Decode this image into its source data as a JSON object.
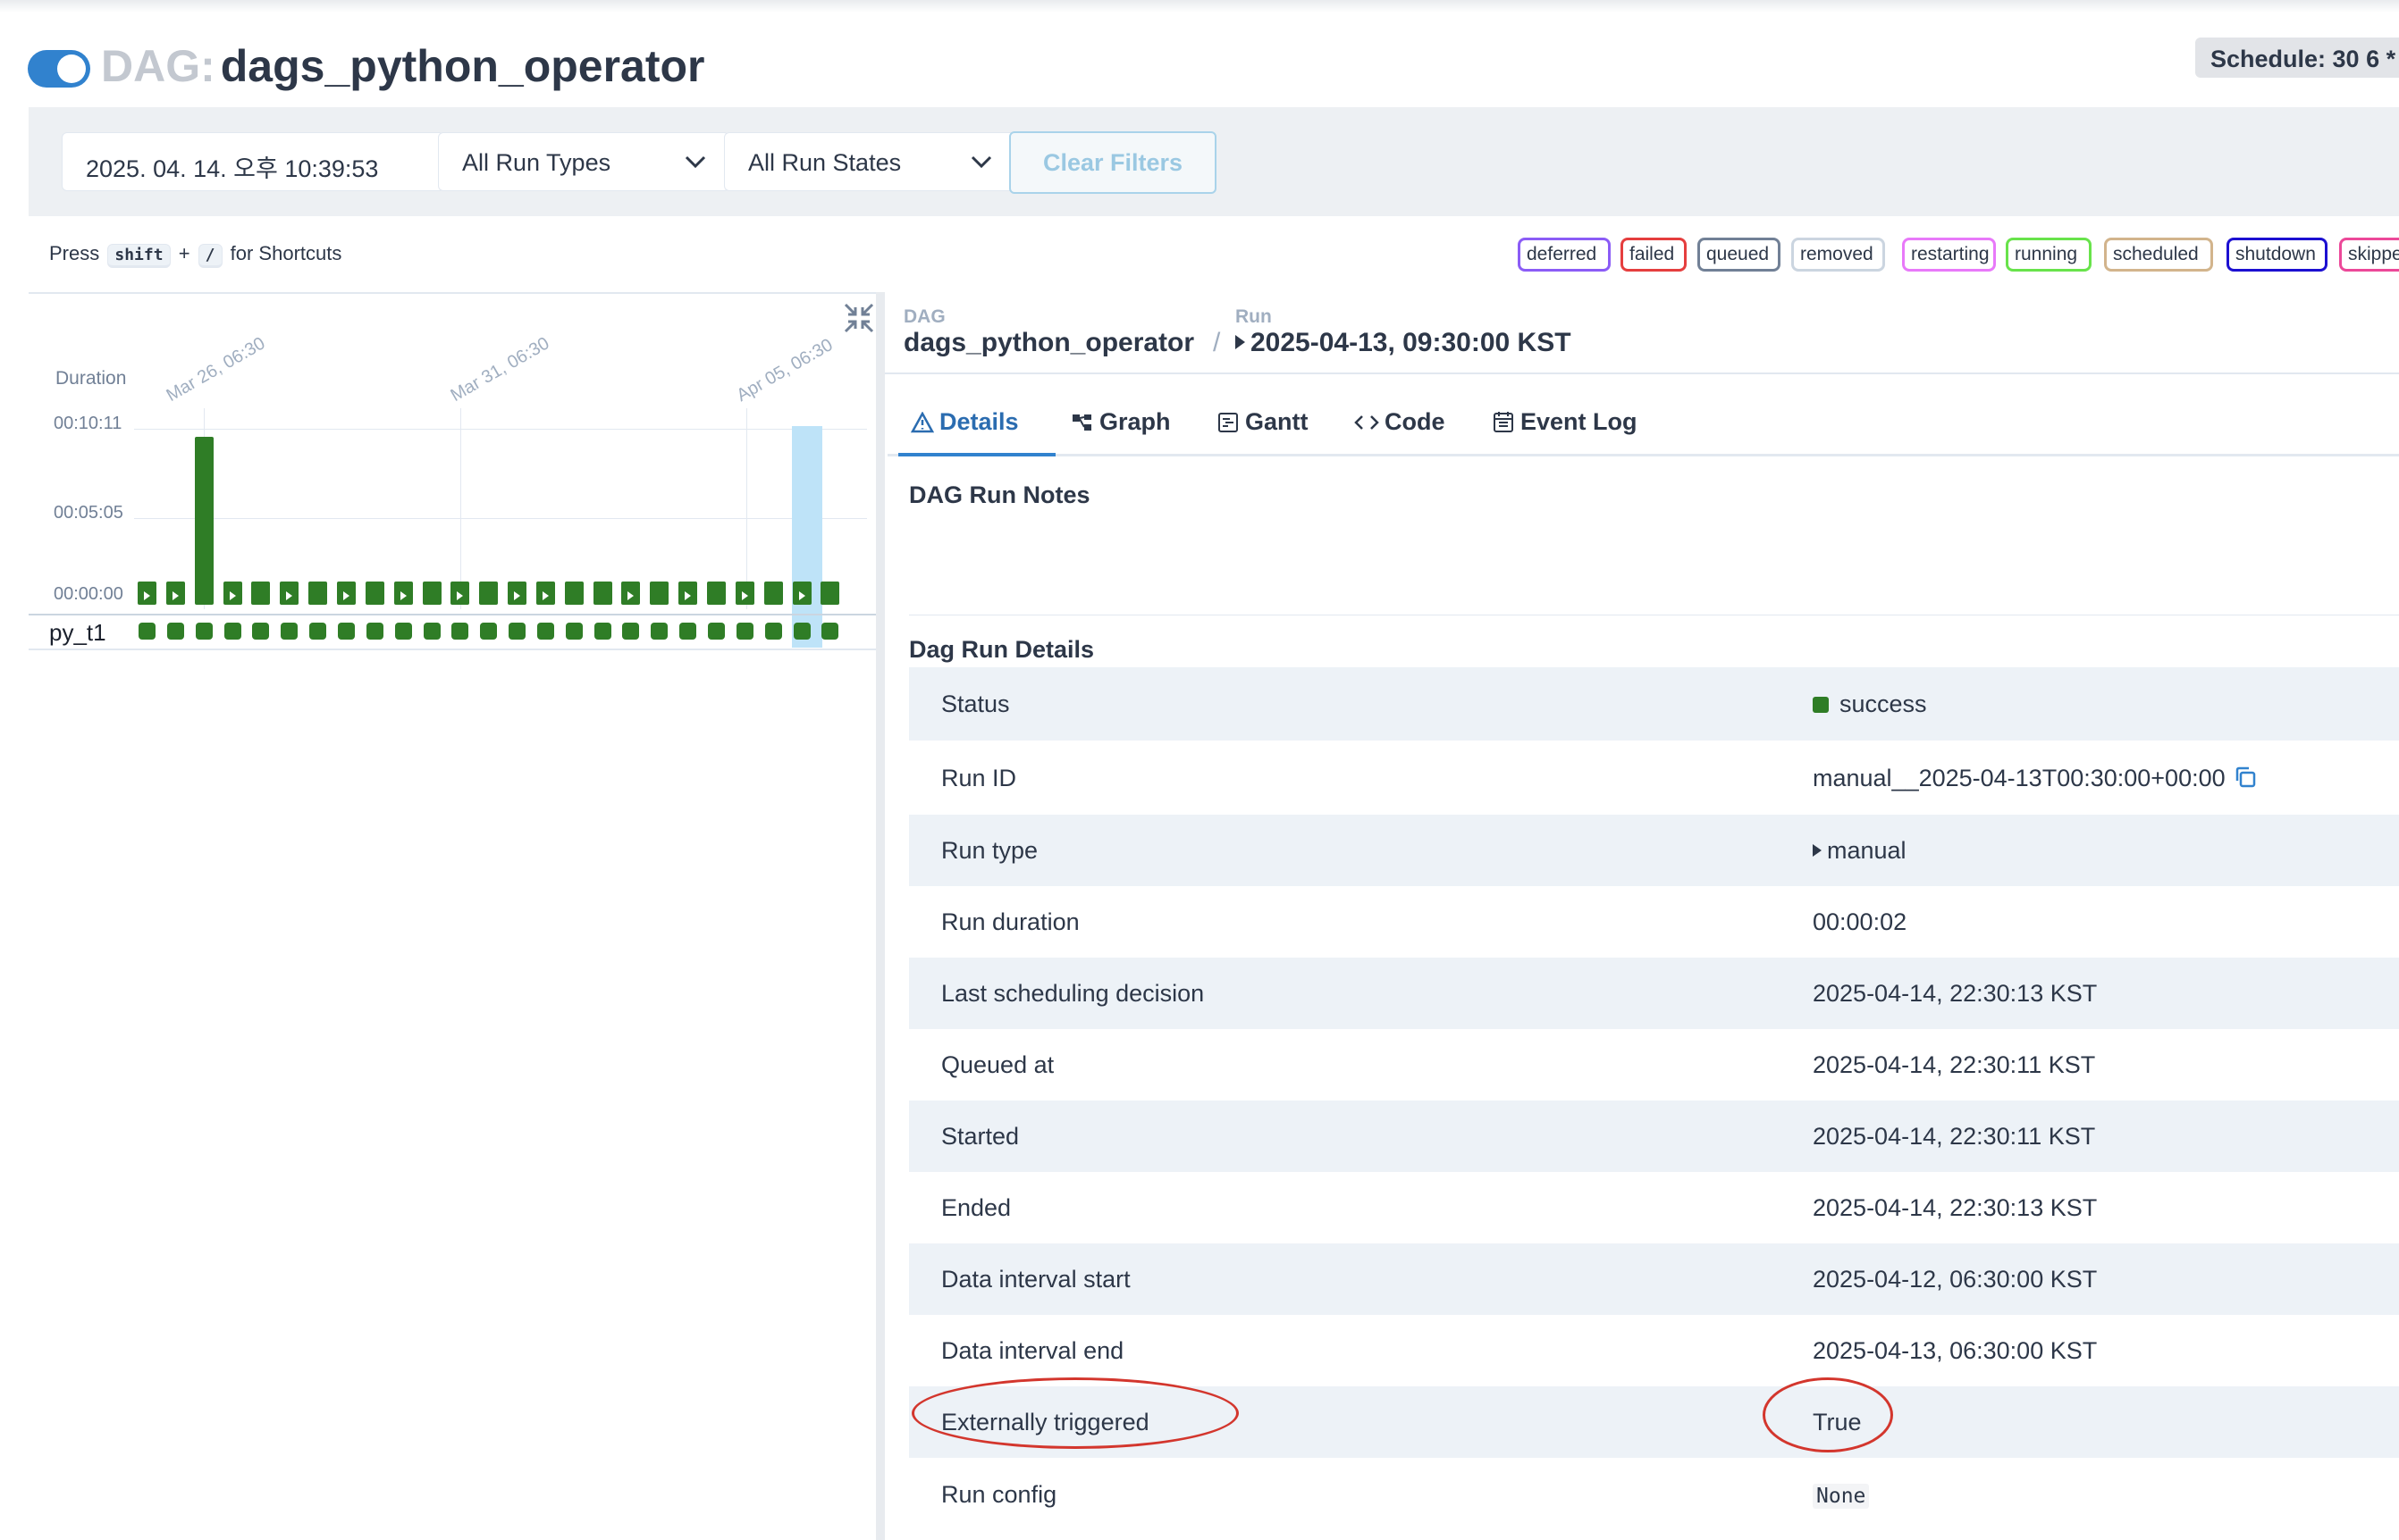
{
  "header": {
    "dag_prefix": "DAG:",
    "dag_name": "dags_python_operator",
    "schedule": "Schedule: 30 6 *",
    "toggle_on": true
  },
  "filters": {
    "date_value": "2025. 04. 14. 오후 10:39:53",
    "run_types": "All Run Types",
    "run_states": "All Run States",
    "clear": "Clear Filters"
  },
  "shortcut_hint": {
    "press": "Press",
    "key1": "shift",
    "plus": "+",
    "key2": "/",
    "suffix": "for Shortcuts"
  },
  "legend": [
    {
      "label": "deferred",
      "color": "#8b5cf6"
    },
    {
      "label": "failed",
      "color": "#e53e3e"
    },
    {
      "label": "queued",
      "color": "#718096"
    },
    {
      "label": "removed",
      "color": "#cbd5e0"
    },
    {
      "label": "restarting",
      "color": "#e879f9"
    },
    {
      "label": "running",
      "color": "#68e34b"
    },
    {
      "label": "scheduled",
      "color": "#d2b48c"
    },
    {
      "label": "shutdown",
      "color": "#1c10d1"
    },
    {
      "label": "skipped",
      "color": "#ec4899"
    }
  ],
  "grid": {
    "duration_label": "Duration",
    "y_ticks": [
      "00:10:11",
      "00:05:05",
      "00:00:00"
    ],
    "date_ticks": [
      "Mar 26, 06:30",
      "Mar 31, 06:30",
      "Apr 05, 06:30"
    ],
    "task_name": "py_t1",
    "runs": [
      {
        "tall": false,
        "manual": true
      },
      {
        "tall": false,
        "manual": true
      },
      {
        "tall": true,
        "manual": false
      },
      {
        "tall": false,
        "manual": true
      },
      {
        "tall": false,
        "manual": false
      },
      {
        "tall": false,
        "manual": true
      },
      {
        "tall": false,
        "manual": false
      },
      {
        "tall": false,
        "manual": true
      },
      {
        "tall": false,
        "manual": false
      },
      {
        "tall": false,
        "manual": true
      },
      {
        "tall": false,
        "manual": false
      },
      {
        "tall": false,
        "manual": true
      },
      {
        "tall": false,
        "manual": false
      },
      {
        "tall": false,
        "manual": true
      },
      {
        "tall": false,
        "manual": true
      },
      {
        "tall": false,
        "manual": false
      },
      {
        "tall": false,
        "manual": false
      },
      {
        "tall": false,
        "manual": true
      },
      {
        "tall": false,
        "manual": false
      },
      {
        "tall": false,
        "manual": true
      },
      {
        "tall": false,
        "manual": false
      },
      {
        "tall": false,
        "manual": true
      },
      {
        "tall": false,
        "manual": false
      },
      {
        "tall": false,
        "manual": true
      },
      {
        "tall": false,
        "manual": false
      }
    ]
  },
  "breadcrumb": {
    "dag_label": "DAG",
    "dag_name": "dags_python_operator",
    "separator": "/",
    "run_label": "Run",
    "run_name": "2025-04-13, 09:30:00 KST"
  },
  "tabs": [
    {
      "label": "Details",
      "icon": "warning-triangle-icon",
      "active": true
    },
    {
      "label": "Graph",
      "icon": "graph-icon",
      "active": false
    },
    {
      "label": "Gantt",
      "icon": "gantt-icon",
      "active": false
    },
    {
      "label": "Code",
      "icon": "code-icon",
      "active": false
    },
    {
      "label": "Event Log",
      "icon": "calendar-icon",
      "active": false
    }
  ],
  "notes_heading": "DAG Run Notes",
  "details_heading": "Dag Run Details",
  "details": [
    {
      "key": "Status",
      "value": "success"
    },
    {
      "key": "Run ID",
      "value": "manual__2025-04-13T00:30:00+00:00"
    },
    {
      "key": "Run type",
      "value": "manual"
    },
    {
      "key": "Run duration",
      "value": "00:00:02"
    },
    {
      "key": "Last scheduling decision",
      "value": "2025-04-14, 22:30:13 KST"
    },
    {
      "key": "Queued at",
      "value": "2025-04-14, 22:30:11 KST"
    },
    {
      "key": "Started",
      "value": "2025-04-14, 22:30:11 KST"
    },
    {
      "key": "Ended",
      "value": "2025-04-14, 22:30:13 KST"
    },
    {
      "key": "Data interval start",
      "value": "2025-04-12, 06:30:00 KST"
    },
    {
      "key": "Data interval end",
      "value": "2025-04-13, 06:30:00 KST"
    },
    {
      "key": "Externally triggered",
      "value": "True"
    },
    {
      "key": "Run config",
      "value": "None"
    }
  ],
  "colors": {
    "success": "#2f7d26",
    "accent": "#3182ce",
    "annotation": "#d3362d"
  }
}
